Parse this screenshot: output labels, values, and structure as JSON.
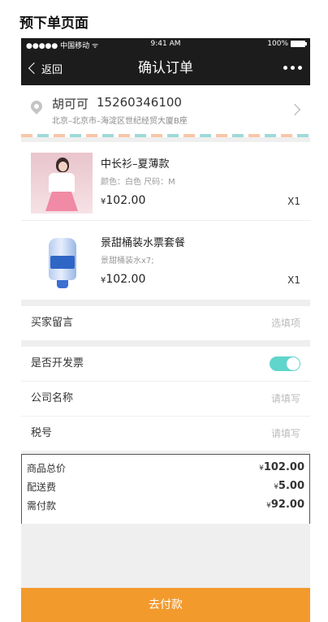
{
  "caption": "预下单页面",
  "statusbar": {
    "carrier": "●●●●● 中国移动 ᯤ",
    "time": "9:41 AM",
    "battery": "100%"
  },
  "navbar": {
    "back_label": "返回",
    "title": "确认订单"
  },
  "address": {
    "name": "胡可可",
    "phone": "15260346100",
    "detail": "北京–北京市–海淀区世纪经贸大厦B座"
  },
  "products": [
    {
      "name": "中长衫–夏薄款",
      "spec": "颜色：白色 尺码：M",
      "currency": "¥",
      "price": "102.00",
      "qty": "X1"
    },
    {
      "name": "景甜桶装水票套餐",
      "spec": "景甜桶装水x7;",
      "currency": "¥",
      "price": "102.00",
      "qty": "X1"
    }
  ],
  "message": {
    "label": "买家留言",
    "placeholder": "选填项"
  },
  "invoice": {
    "toggle_label": "是否开发票",
    "toggle_on": true,
    "company_label": "公司名称",
    "company_placeholder": "请填写",
    "tax_label": "税号",
    "tax_placeholder": "请填写"
  },
  "summary": {
    "goods_total_label": "商品总价",
    "goods_total_currency": "¥",
    "goods_total": "102.00",
    "shipping_label": "配送费",
    "shipping_currency": "¥",
    "shipping": "5.00",
    "payable_label": "需付款",
    "payable_currency": "¥",
    "payable": "92.00"
  },
  "pay_button": "去付款",
  "colors": {
    "nav_bg": "#1c1c1c",
    "toggle_on": "#5fd5cc",
    "pay_bar": "#f39a2d"
  }
}
